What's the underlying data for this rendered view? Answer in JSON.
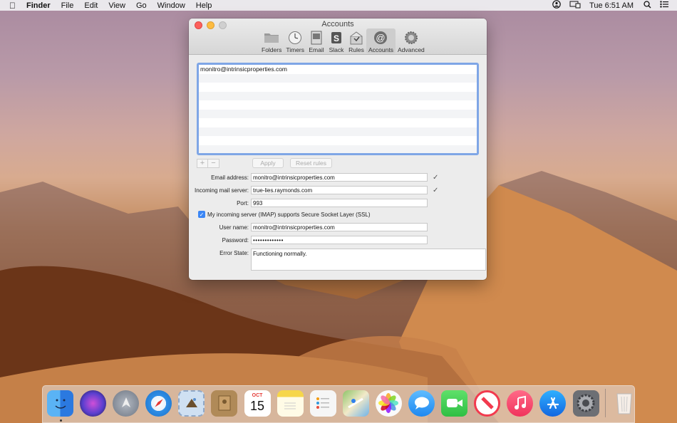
{
  "menubar": {
    "app_name": "Finder",
    "items": [
      "File",
      "Edit",
      "View",
      "Go",
      "Window",
      "Help"
    ],
    "clock": "Tue 6:51 AM",
    "icons": [
      "apple-icon",
      "user-switch-icon",
      "display-icon",
      "search-icon",
      "control-list-icon"
    ]
  },
  "window": {
    "title": "Accounts",
    "toolbar": [
      {
        "label": "Folders",
        "icon": "folder-icon"
      },
      {
        "label": "Timers",
        "icon": "clock-icon"
      },
      {
        "label": "Email",
        "icon": "email-icon"
      },
      {
        "label": "Slack",
        "icon": "slack-icon"
      },
      {
        "label": "Rules",
        "icon": "rules-icon"
      },
      {
        "label": "Accounts",
        "icon": "at-icon",
        "selected": true
      },
      {
        "label": "Advanced",
        "icon": "gear-icon"
      }
    ],
    "accounts_list": [
      "monitro@intrinsicproperties.com"
    ],
    "buttons": {
      "add": "+",
      "remove": "−",
      "apply": "Apply",
      "reset": "Reset rules"
    },
    "form": {
      "email_label": "Email address:",
      "email_value": "monitro@intrinsicproperties.com",
      "server_label": "Incoming mail server:",
      "server_value": "true-lies.raymonds.com",
      "port_label": "Port:",
      "port_value": "993",
      "ssl_label": "My incoming server (IMAP) supports Secure Socket Layer (SSL)",
      "ssl_checked": true,
      "user_label": "User name:",
      "user_value": "monitro@intrinsicproperties.com",
      "password_label": "Password:",
      "password_value": "•••••••••••••",
      "error_label": "Error State:",
      "error_value": "Functioning normally."
    }
  },
  "dock": {
    "apps": [
      {
        "name": "finder-icon",
        "color": "#3c8ef0"
      },
      {
        "name": "siri-icon",
        "color": "#5a3fcf"
      },
      {
        "name": "launchpad-icon",
        "color": "#8a93a0"
      },
      {
        "name": "safari-icon",
        "color": "#2f8fe6"
      },
      {
        "name": "mail-stamp-icon",
        "color": "#5a8fcf"
      },
      {
        "name": "contacts-icon",
        "color": "#b08a58"
      },
      {
        "name": "calendar-icon",
        "color": "#ffffff",
        "month": "OCT",
        "day": "15"
      },
      {
        "name": "notes-icon",
        "color": "#f6d64a"
      },
      {
        "name": "reminders-icon",
        "color": "#f4f4f4"
      },
      {
        "name": "maps-icon",
        "color": "#8fc46a"
      },
      {
        "name": "photos-icon",
        "color": "#f7f7f7"
      },
      {
        "name": "messages-icon",
        "color": "#3ca0f5"
      },
      {
        "name": "facetime-icon",
        "color": "#34c24a"
      },
      {
        "name": "news-icon",
        "color": "#f23a4e"
      },
      {
        "name": "music-icon",
        "color": "#f04a6a"
      },
      {
        "name": "app-store-icon",
        "color": "#1e8ef3"
      },
      {
        "name": "system-preferences-icon",
        "color": "#7d7f84"
      }
    ],
    "trash": "trash-icon"
  }
}
